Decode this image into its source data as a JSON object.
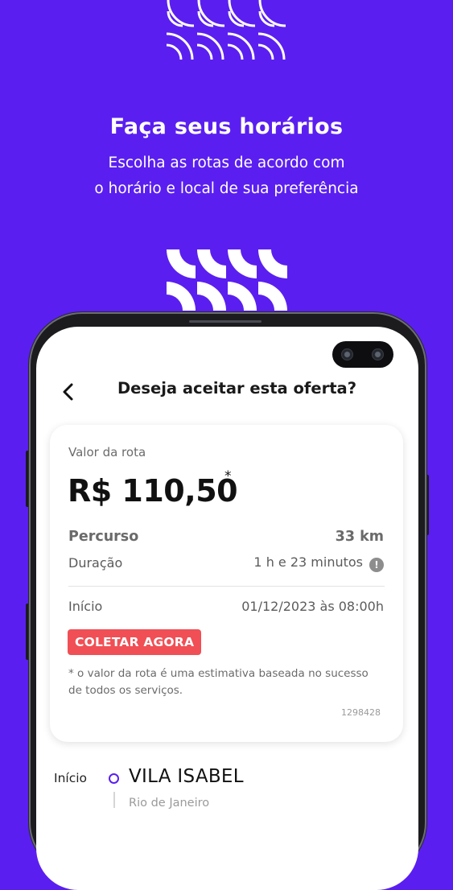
{
  "hero": {
    "title": "Faça seus horários",
    "subtitle_line1": "Escolha as rotas de acordo com",
    "subtitle_line2": "o horário e local de sua preferência"
  },
  "colors": {
    "background": "#5a1ff0",
    "badge": "#f04f55",
    "accent": "#5a1ff0"
  },
  "screen": {
    "header": {
      "back_icon": "chevron-left-icon",
      "title": "Deseja aceitar esta oferta?"
    },
    "card": {
      "route_value_label": "Valor da rota",
      "price": "R$ 110,50",
      "price_asterisk": "*",
      "distance_label": "Percurso",
      "distance_value": "33 km",
      "duration_label": "Duração",
      "duration_value": "1 h e 23 minutos",
      "duration_info_icon": "info-icon",
      "duration_info_glyph": "!",
      "start_label": "Início",
      "start_value": "01/12/2023 às 08:00h",
      "status_badge": "COLETAR AGORA",
      "note": "* o valor da rota é uma estimativa baseada no sucesso de todos os serviços.",
      "code": "1298428"
    },
    "stops": [
      {
        "label": "Início",
        "name": "VILA ISABEL",
        "sub": "Rio de Janeiro"
      }
    ]
  }
}
